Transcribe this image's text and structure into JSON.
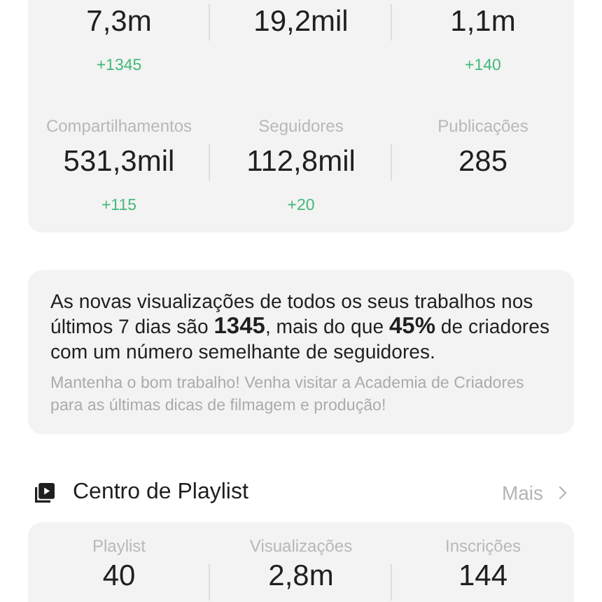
{
  "stats_card": {
    "rows": [
      {
        "cells": [
          {
            "value": "7,3m",
            "delta": "+1345"
          },
          {
            "value": "19,2mil"
          },
          {
            "value": "1,1m",
            "delta": "+140"
          }
        ]
      },
      {
        "cells": [
          {
            "label": "Compartilhamentos",
            "value": "531,3mil",
            "delta": "+115"
          },
          {
            "label": "Seguidores",
            "value": "112,8mil",
            "delta": "+20"
          },
          {
            "label": "Publicações",
            "value": "285"
          }
        ]
      }
    ]
  },
  "insight": {
    "message": "As novas visualizações de todos os seus trabalhos nos últimos 7 dias são **1345**, mais do que **45%** de criadores com um número semelhante de seguidores.",
    "tip": "Mantenha o bom trabalho! Venha visitar a Academia de Criadores para as últimas dicas de filmagem e produção!"
  },
  "playlist_center": {
    "title": "Centro de Playlist",
    "more": "Mais",
    "stats": [
      {
        "label": "Playlist",
        "value": "40"
      },
      {
        "label": "Visualizações",
        "value": "2,8m"
      },
      {
        "label": "Inscrições",
        "value": "144"
      }
    ]
  }
}
